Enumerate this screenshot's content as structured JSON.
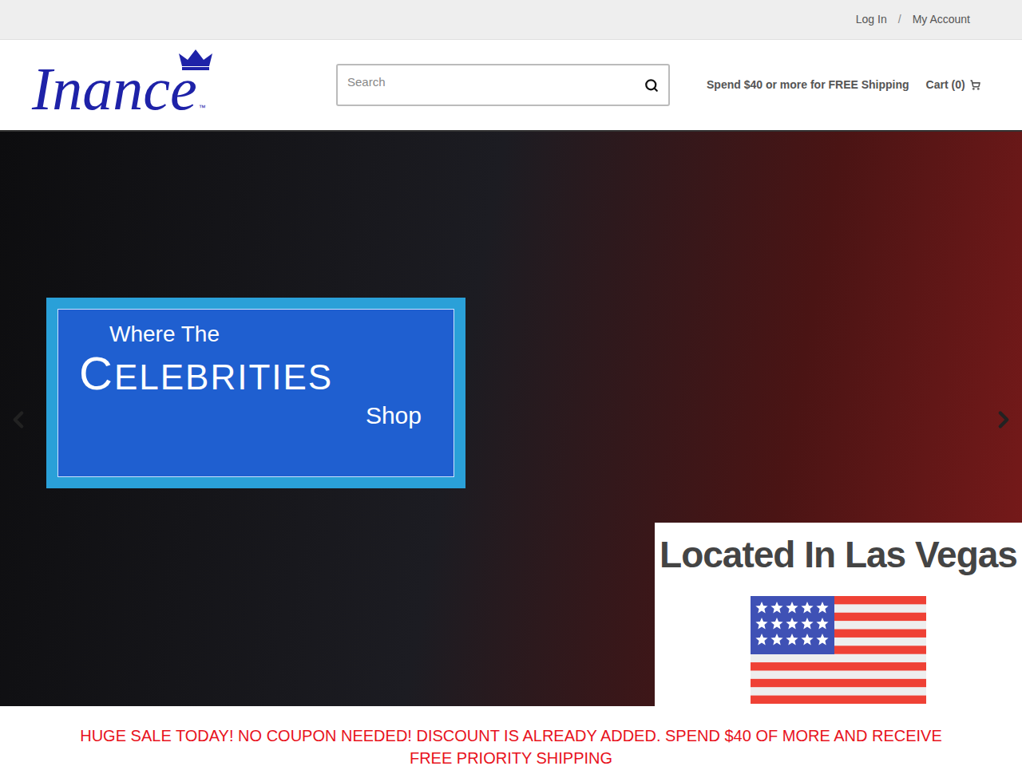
{
  "top_bar": {
    "links": [
      "Log In",
      "My Account"
    ],
    "separator": "/"
  },
  "logo": {
    "text": "Inance",
    "trademark": "™"
  },
  "search": {
    "placeholder": "Search"
  },
  "shipping_note": "Spend $40 or more for FREE Shipping",
  "cart": {
    "label": "Cart (0)"
  },
  "hero": {
    "banner": {
      "line1": "Where The",
      "line2": "CELEBRITIES",
      "line3": "Shop"
    },
    "location": "Located In Las Vegas"
  },
  "announcement": "HUGE SALE TODAY! NO COUPON NEEDED! DISCOUNT IS ALREADY ADDED. SPEND $40 OF MORE AND RECEIVE FREE PRIORITY SHIPPING"
}
